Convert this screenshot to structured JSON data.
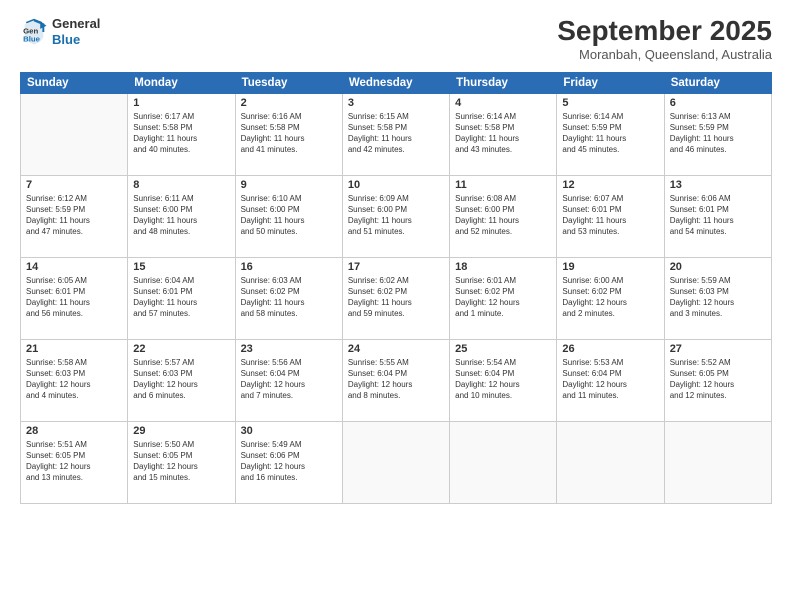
{
  "logo": {
    "line1": "General",
    "line2": "Blue"
  },
  "header": {
    "month": "September 2025",
    "location": "Moranbah, Queensland, Australia"
  },
  "weekdays": [
    "Sunday",
    "Monday",
    "Tuesday",
    "Wednesday",
    "Thursday",
    "Friday",
    "Saturday"
  ],
  "weeks": [
    [
      {
        "day": "",
        "info": ""
      },
      {
        "day": "1",
        "info": "Sunrise: 6:17 AM\nSunset: 5:58 PM\nDaylight: 11 hours\nand 40 minutes."
      },
      {
        "day": "2",
        "info": "Sunrise: 6:16 AM\nSunset: 5:58 PM\nDaylight: 11 hours\nand 41 minutes."
      },
      {
        "day": "3",
        "info": "Sunrise: 6:15 AM\nSunset: 5:58 PM\nDaylight: 11 hours\nand 42 minutes."
      },
      {
        "day": "4",
        "info": "Sunrise: 6:14 AM\nSunset: 5:58 PM\nDaylight: 11 hours\nand 43 minutes."
      },
      {
        "day": "5",
        "info": "Sunrise: 6:14 AM\nSunset: 5:59 PM\nDaylight: 11 hours\nand 45 minutes."
      },
      {
        "day": "6",
        "info": "Sunrise: 6:13 AM\nSunset: 5:59 PM\nDaylight: 11 hours\nand 46 minutes."
      }
    ],
    [
      {
        "day": "7",
        "info": "Sunrise: 6:12 AM\nSunset: 5:59 PM\nDaylight: 11 hours\nand 47 minutes."
      },
      {
        "day": "8",
        "info": "Sunrise: 6:11 AM\nSunset: 6:00 PM\nDaylight: 11 hours\nand 48 minutes."
      },
      {
        "day": "9",
        "info": "Sunrise: 6:10 AM\nSunset: 6:00 PM\nDaylight: 11 hours\nand 50 minutes."
      },
      {
        "day": "10",
        "info": "Sunrise: 6:09 AM\nSunset: 6:00 PM\nDaylight: 11 hours\nand 51 minutes."
      },
      {
        "day": "11",
        "info": "Sunrise: 6:08 AM\nSunset: 6:00 PM\nDaylight: 11 hours\nand 52 minutes."
      },
      {
        "day": "12",
        "info": "Sunrise: 6:07 AM\nSunset: 6:01 PM\nDaylight: 11 hours\nand 53 minutes."
      },
      {
        "day": "13",
        "info": "Sunrise: 6:06 AM\nSunset: 6:01 PM\nDaylight: 11 hours\nand 54 minutes."
      }
    ],
    [
      {
        "day": "14",
        "info": "Sunrise: 6:05 AM\nSunset: 6:01 PM\nDaylight: 11 hours\nand 56 minutes."
      },
      {
        "day": "15",
        "info": "Sunrise: 6:04 AM\nSunset: 6:01 PM\nDaylight: 11 hours\nand 57 minutes."
      },
      {
        "day": "16",
        "info": "Sunrise: 6:03 AM\nSunset: 6:02 PM\nDaylight: 11 hours\nand 58 minutes."
      },
      {
        "day": "17",
        "info": "Sunrise: 6:02 AM\nSunset: 6:02 PM\nDaylight: 11 hours\nand 59 minutes."
      },
      {
        "day": "18",
        "info": "Sunrise: 6:01 AM\nSunset: 6:02 PM\nDaylight: 12 hours\nand 1 minute."
      },
      {
        "day": "19",
        "info": "Sunrise: 6:00 AM\nSunset: 6:02 PM\nDaylight: 12 hours\nand 2 minutes."
      },
      {
        "day": "20",
        "info": "Sunrise: 5:59 AM\nSunset: 6:03 PM\nDaylight: 12 hours\nand 3 minutes."
      }
    ],
    [
      {
        "day": "21",
        "info": "Sunrise: 5:58 AM\nSunset: 6:03 PM\nDaylight: 12 hours\nand 4 minutes."
      },
      {
        "day": "22",
        "info": "Sunrise: 5:57 AM\nSunset: 6:03 PM\nDaylight: 12 hours\nand 6 minutes."
      },
      {
        "day": "23",
        "info": "Sunrise: 5:56 AM\nSunset: 6:04 PM\nDaylight: 12 hours\nand 7 minutes."
      },
      {
        "day": "24",
        "info": "Sunrise: 5:55 AM\nSunset: 6:04 PM\nDaylight: 12 hours\nand 8 minutes."
      },
      {
        "day": "25",
        "info": "Sunrise: 5:54 AM\nSunset: 6:04 PM\nDaylight: 12 hours\nand 10 minutes."
      },
      {
        "day": "26",
        "info": "Sunrise: 5:53 AM\nSunset: 6:04 PM\nDaylight: 12 hours\nand 11 minutes."
      },
      {
        "day": "27",
        "info": "Sunrise: 5:52 AM\nSunset: 6:05 PM\nDaylight: 12 hours\nand 12 minutes."
      }
    ],
    [
      {
        "day": "28",
        "info": "Sunrise: 5:51 AM\nSunset: 6:05 PM\nDaylight: 12 hours\nand 13 minutes."
      },
      {
        "day": "29",
        "info": "Sunrise: 5:50 AM\nSunset: 6:05 PM\nDaylight: 12 hours\nand 15 minutes."
      },
      {
        "day": "30",
        "info": "Sunrise: 5:49 AM\nSunset: 6:06 PM\nDaylight: 12 hours\nand 16 minutes."
      },
      {
        "day": "",
        "info": ""
      },
      {
        "day": "",
        "info": ""
      },
      {
        "day": "",
        "info": ""
      },
      {
        "day": "",
        "info": ""
      }
    ]
  ]
}
